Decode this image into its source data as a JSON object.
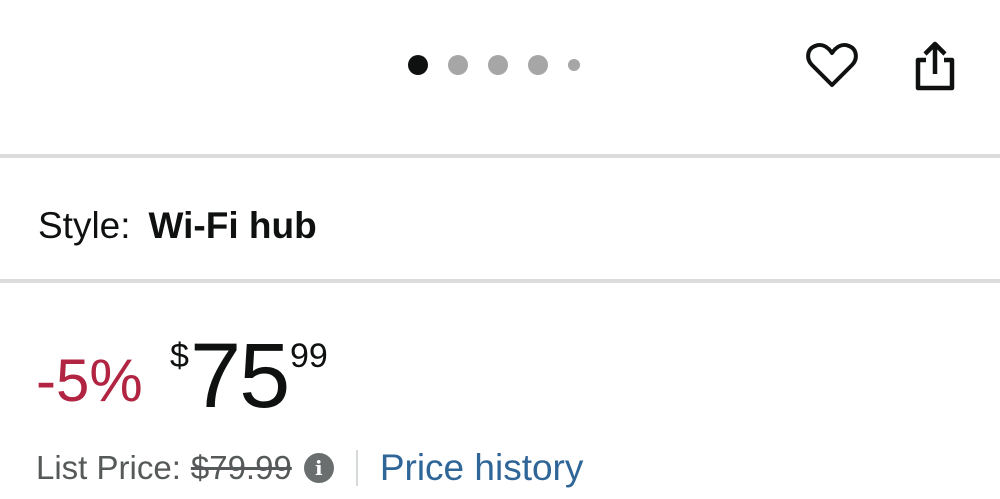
{
  "carousel": {
    "dots": [
      "active",
      "inactive",
      "inactive",
      "inactive",
      "small"
    ]
  },
  "actions": {
    "favorite_icon": "heart-outline-icon",
    "share_icon": "share-icon"
  },
  "style": {
    "label": "Style:",
    "value": "Wi-Fi hub"
  },
  "price": {
    "discount": "-5%",
    "currency": "$",
    "whole": "75",
    "fraction": "99",
    "discount_color": "#b12542"
  },
  "list_price": {
    "label": "List Price:",
    "value": "$79.99",
    "info_icon": "info-icon",
    "info_glyph": "i"
  },
  "price_history": {
    "label": "Price history",
    "color": "#2f6597"
  }
}
